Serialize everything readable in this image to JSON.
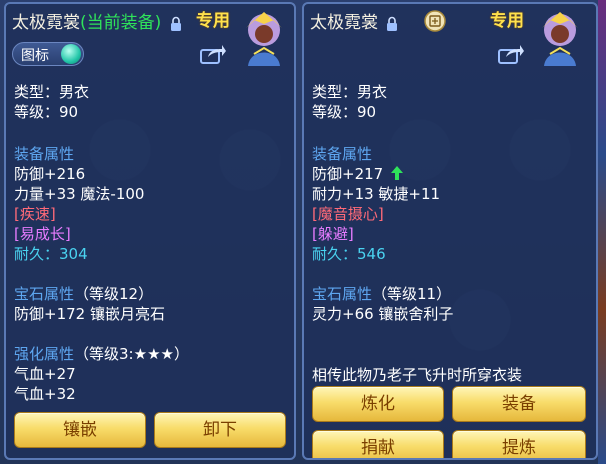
{
  "left": {
    "title": "太极霓裳",
    "current_tag": "(当前装备)",
    "exclusive": "专用",
    "toggle_label": "图标",
    "type": "类型：男衣",
    "level": "等级：90",
    "equip_header": "装备属性",
    "stats": [
      "防御+216",
      "力量+33 魔法-100"
    ],
    "special1": "[疾速]",
    "special2": "[易成长]",
    "durability_label": "耐久：",
    "durability_value": "304",
    "gem_header": "宝石属性",
    "gem_level": "（等级12）",
    "gem_text": "防御+172 镶嵌月亮石",
    "enhance_header": "强化属性",
    "enhance_level": "（等级3:",
    "enhance_stars": "★★★",
    "enhance_close": "）",
    "enhance_stats": [
      "气血+27",
      "气血+32"
    ],
    "btn_inlay": "镶嵌",
    "btn_remove": "卸下"
  },
  "right": {
    "title": "太极霓裳",
    "exclusive": "专用",
    "type": "类型：男衣",
    "level": "等级：90",
    "equip_header": "装备属性",
    "stats": [
      "防御+217",
      "耐力+13 敏捷+11"
    ],
    "special1": "[魔音摄心]",
    "special2": "[躲避]",
    "durability_label": "耐久：",
    "durability_value": "546",
    "gem_header": "宝石属性",
    "gem_level": "（等级11）",
    "gem_text": "灵力+66 镶嵌舍利子",
    "description": "相传此物乃老子飞升时所穿衣装",
    "btn_refine": "炼化",
    "btn_equip": "装备",
    "btn_donate": "捐献",
    "btn_extract": "提炼"
  },
  "colors": {
    "accent_green": "#2fe35a",
    "header_blue": "#5ea6f0",
    "button_gold": "#f8dc6a",
    "exclusive_yellow": "#ffe14d"
  },
  "icons": {
    "lock": "lock-icon",
    "share": "share-icon",
    "avatar": "character-avatar-icon",
    "up": "arrow-up-icon",
    "appraise": "appraise-seal-icon"
  }
}
